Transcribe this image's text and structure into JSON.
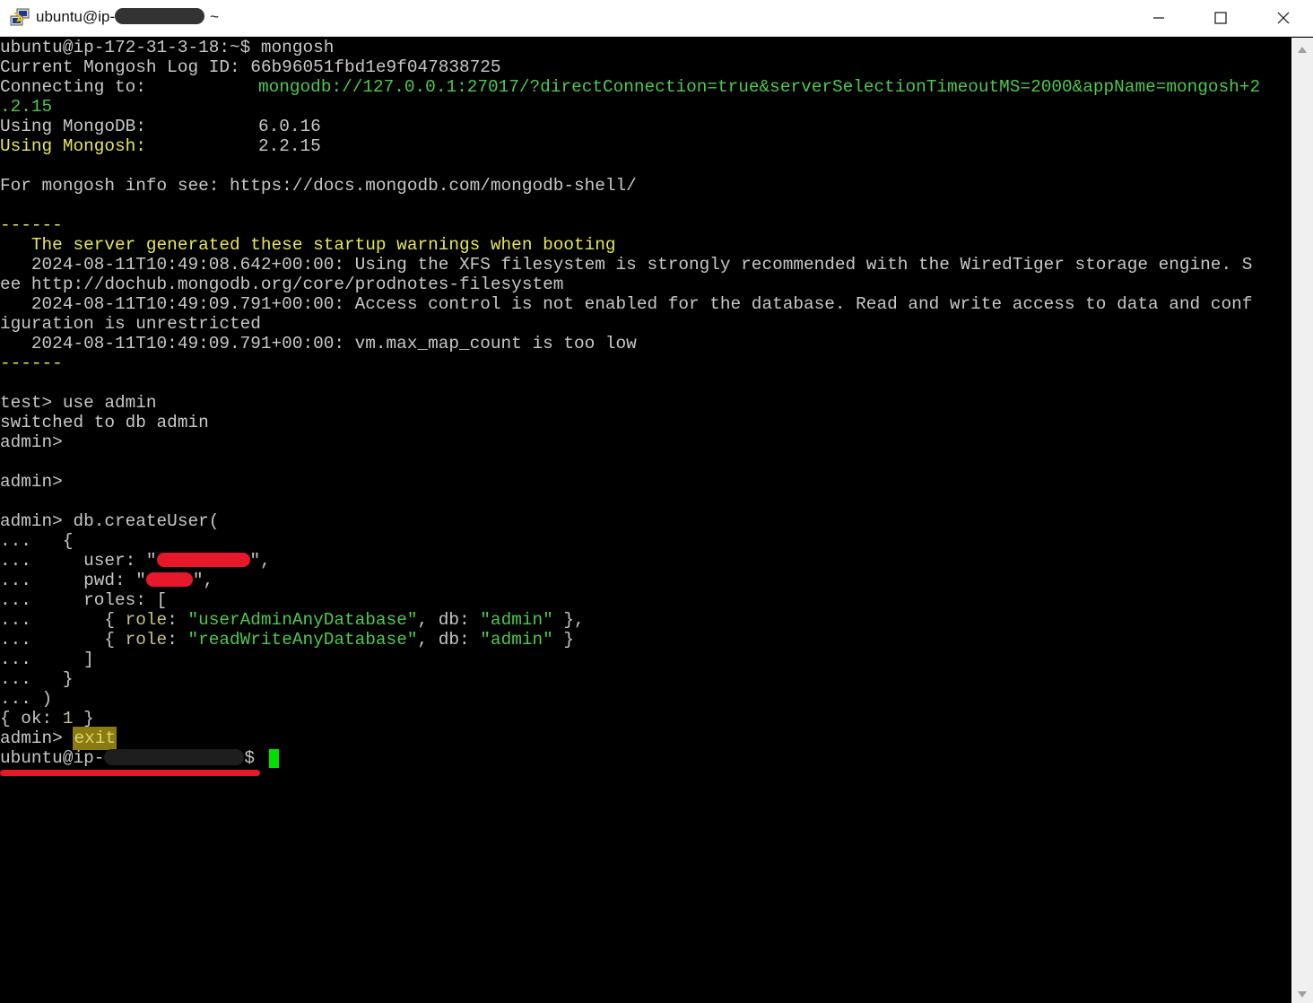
{
  "window": {
    "title_prefix": "ubuntu@ip-",
    "title_suffix": "~",
    "minimize_icon": "minimize-icon",
    "maximize_icon": "maximize-icon",
    "close_icon": "close-icon",
    "app_icon": "putty-icon"
  },
  "terminal": {
    "lines": [
      "ubuntu@ip-172-31-3-18:~$ mongosh",
      "Current Mongosh Log ID: 66b96051fbd1e9f047838725",
      "Connecting to:",
      "mongodb://127.0.0.1:27017/?directConnection=true&serverSelectionTimeoutMS=2000&appName=mongosh+2",
      ".2.15",
      "Using MongoDB:",
      "6.0.16",
      "Using Mongosh:",
      "2.2.15",
      "For mongosh info see: https://docs.mongodb.com/mongodb-shell/",
      "------",
      "   The server generated these startup warnings when booting",
      "   2024-08-11T10:49:08.642+00:00: Using the XFS filesystem is strongly recommended with the WiredTiger storage engine. S",
      "ee http://dochub.mongodb.org/core/prodnotes-filesystem",
      "   2024-08-11T10:49:09.791+00:00: Access control is not enabled for the database. Read and write access to data and conf",
      "iguration is unrestricted",
      "   2024-08-11T10:49:09.791+00:00: vm.max_map_count is too low",
      "------",
      "test> use admin",
      "switched to db admin",
      "admin>",
      "admin>",
      "admin> db.createUser(",
      "...   {",
      "...     user: \"",
      "\",",
      "...     pwd: \"",
      "\",",
      "...     roles: [",
      "...       { ",
      "role",
      ": ",
      "\"userAdminAnyDatabase\"",
      ", db: ",
      "\"admin\"",
      " },",
      "...       { ",
      "role",
      ": ",
      "\"readWriteAnyDatabase\"",
      ", db: ",
      "\"admin\"",
      " }",
      "...     ]",
      "...   }",
      "... )",
      "{ ok: ",
      "1",
      " }",
      "admin> ",
      "exit",
      "ubuntu@ip-",
      "$ "
    ]
  }
}
